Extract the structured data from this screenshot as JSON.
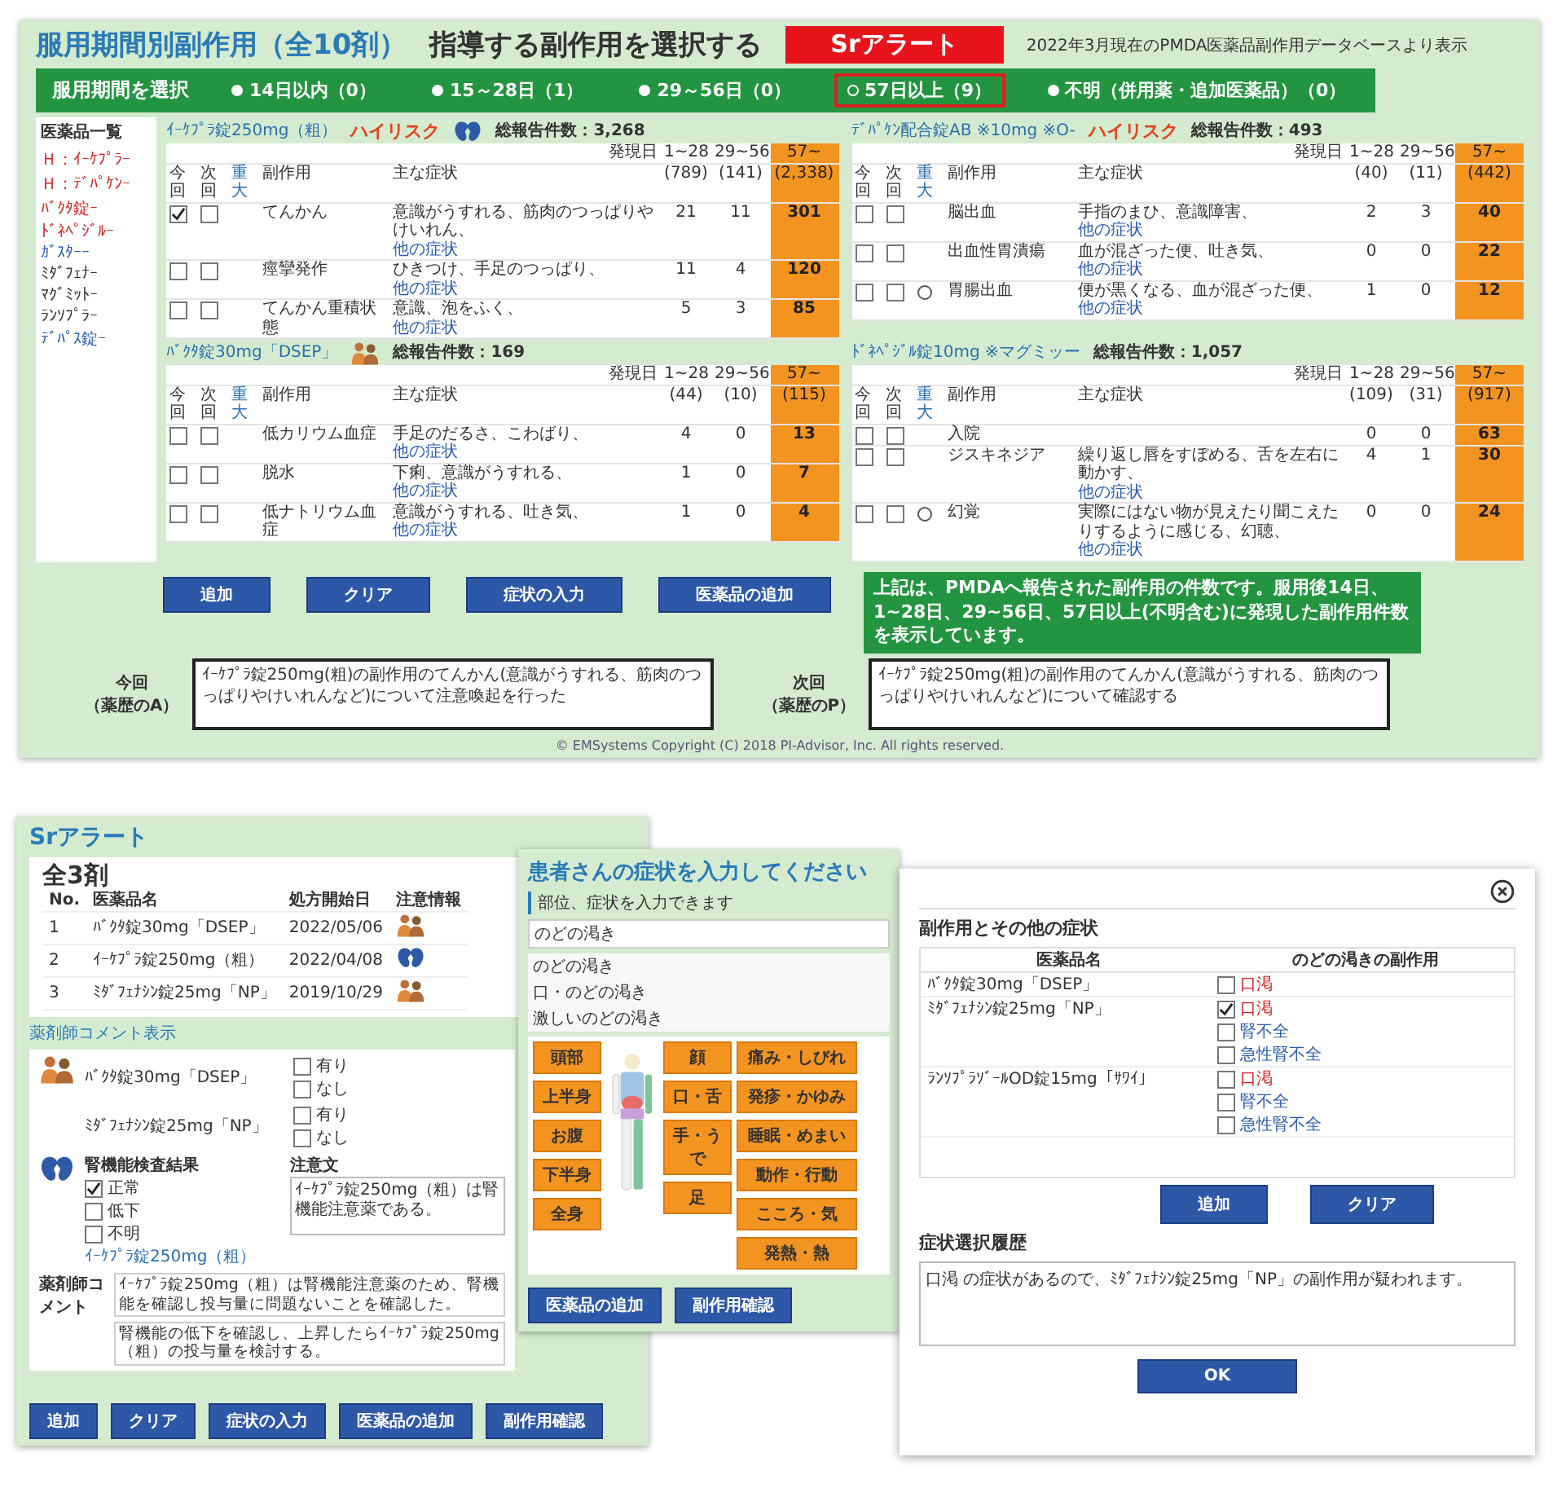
{
  "main": {
    "title": "服用期間別副作用（全10剤）",
    "subtitle": "指導する副作用を選択する",
    "alert_button": "Srアラート",
    "source_note": "2022年3月現在のPMDA医薬品副作用データベースより表示",
    "period_label": "服用期間を選択",
    "periods": [
      {
        "label": "14日以内（0）",
        "selected": false
      },
      {
        "label": "15～28日（1）",
        "selected": false
      },
      {
        "label": "29～56日（0）",
        "selected": false
      },
      {
        "label": "57日以上（9）",
        "selected": true
      },
      {
        "label": "不明（併用薬・追加医薬品）（0）",
        "selected": false
      }
    ],
    "sidebar": {
      "title": "医薬品一覧",
      "items": [
        {
          "label": "Ｈ：ｲｰｹﾌﾟﾗｰ",
          "color": "#d02828"
        },
        {
          "label": "Ｈ：ﾃﾞﾊﾟｹﾝｰ",
          "color": "#d02828"
        },
        {
          "label": "ﾊﾞｸﾀ錠ｰ",
          "color": "#d02828"
        },
        {
          "label": "ﾄﾞﾈﾍﾟｼﾞﾙｰ",
          "color": "#d02828"
        },
        {
          "label": "ｶﾞｽﾀｰｰ",
          "color": "#2a5db0"
        },
        {
          "label": "ﾐﾀﾞﾌｪﾅｰ",
          "color": "#333333"
        },
        {
          "label": "ﾏｸﾞﾐｯﾄｰ",
          "color": "#333333"
        },
        {
          "label": "ﾗﾝｿﾌﾟﾗｰ",
          "color": "#333333"
        },
        {
          "label": "ﾃﾞﾊﾟｽ錠ｰ",
          "color": "#2a5db0"
        }
      ]
    },
    "drugs": [
      {
        "name": "ｲｰｹﾌﾟﾗ錠250mg（粗）",
        "high_risk": "ハイリスク",
        "kind": "kidney",
        "total": "総報告件数：3,268",
        "onset_label": "発現日",
        "periods": [
          "1~28",
          "29~56",
          "57~"
        ],
        "counts": [
          "(789)",
          "(141)",
          "(2,338)"
        ],
        "columns": [
          "今回",
          "次回",
          "重大",
          "副作用",
          "主な症状"
        ],
        "rows": [
          {
            "now": true,
            "next": false,
            "serious": false,
            "effect": "てんかん",
            "symptom": "意識がうすれる、筋肉のつっぱりやけいれん、",
            "link": "他の症状",
            "values": [
              "21",
              "11",
              "301"
            ]
          },
          {
            "now": false,
            "next": false,
            "serious": false,
            "effect": "痙攣発作",
            "symptom": "ひきつけ、手足のつっぱり、",
            "link": "他の症状",
            "values": [
              "11",
              "4",
              "120"
            ]
          },
          {
            "now": false,
            "next": false,
            "serious": false,
            "effect": "てんかん重積状態",
            "symptom": "意識、泡をふく、",
            "link": "他の症状",
            "values": [
              "5",
              "3",
              "85"
            ]
          }
        ]
      },
      {
        "name": "ﾃﾞﾊﾟｹﾝ配合錠AB ※10mg ※O-",
        "high_risk": "ハイリスク",
        "total": "総報告件数：493",
        "onset_label": "発現日",
        "periods": [
          "1~28",
          "29~56",
          "57~"
        ],
        "counts": [
          "(40)",
          "(11)",
          "(442)"
        ],
        "columns": [
          "今回",
          "次回",
          "重大",
          "副作用",
          "主な症状"
        ],
        "rows": [
          {
            "now": false,
            "next": false,
            "serious": false,
            "effect": "脳出血",
            "symptom": "手指のまひ、意識障害、",
            "link": "他の症状",
            "values": [
              "2",
              "3",
              "40"
            ]
          },
          {
            "now": false,
            "next": false,
            "serious": false,
            "effect": "出血性胃潰瘍",
            "symptom": "血が混ざった便、吐き気、",
            "link": "他の症状",
            "values": [
              "0",
              "0",
              "22"
            ]
          },
          {
            "now": false,
            "next": false,
            "serious": true,
            "effect": "胃腸出血",
            "symptom": "便が黒くなる、血が混ざった便、",
            "link": "他の症状",
            "values": [
              "1",
              "0",
              "12"
            ]
          }
        ]
      },
      {
        "name": "ﾊﾞｸﾀ錠30mg「DSEP」",
        "kind": "people",
        "total": "総報告件数：169",
        "onset_label": "発現日",
        "periods": [
          "1~28",
          "29~56",
          "57~"
        ],
        "counts": [
          "(44)",
          "(10)",
          "(115)"
        ],
        "columns": [
          "今回",
          "次回",
          "重大",
          "副作用",
          "主な症状"
        ],
        "rows": [
          {
            "now": false,
            "next": false,
            "serious": false,
            "effect": "低カリウム血症",
            "symptom": "手足のだるさ、こわばり、",
            "link": "他の症状",
            "values": [
              "4",
              "0",
              "13"
            ]
          },
          {
            "now": false,
            "next": false,
            "serious": false,
            "effect": "脱水",
            "symptom": "下痢、意識がうすれる、",
            "link": "他の症状",
            "values": [
              "1",
              "0",
              "7"
            ]
          },
          {
            "now": false,
            "next": false,
            "serious": false,
            "effect": "低ナトリウム血症",
            "symptom": "意識がうすれる、吐き気、",
            "link": "他の症状",
            "values": [
              "1",
              "0",
              "4"
            ]
          }
        ]
      },
      {
        "name": "ﾄﾞﾈﾍﾟｼﾞﾙ錠10mg ※マグミッー",
        "total": "総報告件数：1,057",
        "onset_label": "発現日",
        "periods": [
          "1~28",
          "29~56",
          "57~"
        ],
        "counts": [
          "(109)",
          "(31)",
          "(917)"
        ],
        "columns": [
          "今回",
          "次回",
          "重大",
          "副作用",
          "主な症状"
        ],
        "rows": [
          {
            "now": false,
            "next": false,
            "serious": false,
            "effect": "入院",
            "values": [
              "0",
              "0",
              "63"
            ]
          },
          {
            "now": false,
            "next": false,
            "serious": false,
            "effect": "ジスキネジア",
            "symptom": "繰り返し唇をすぼめる、舌を左右に動かす、",
            "link": "他の症状",
            "values": [
              "4",
              "1",
              "30"
            ]
          },
          {
            "now": false,
            "next": false,
            "serious": true,
            "effect": "幻覚",
            "symptom": "実際にはない物が見えたり聞こえたりするように感じる、幻聴、",
            "link": "他の症状",
            "values": [
              "0",
              "0",
              "24"
            ]
          }
        ]
      }
    ],
    "buttons": [
      "追加",
      "クリア",
      "症状の入力",
      "医薬品の追加"
    ],
    "note": "上記は、PMDAへ報告された副作用の件数です。服用後14日、1~28日、29~56日、57日以上(不明含む)に発現した副作用件数を表示しています。",
    "memos": [
      {
        "label": "今回",
        "sublabel": "（薬歴のA）",
        "text": "ｲｰｹﾌﾟﾗ錠250mg(粗)の副作用のてんかん(意識がうすれる、筋肉のつっぱりやけいれんなど)について注意喚起を行った"
      },
      {
        "label": "次回",
        "sublabel": "（薬歴のP）",
        "text": "ｲｰｹﾌﾟﾗ錠250mg(粗)の副作用のてんかん(意識がうすれる、筋肉のつっぱりやけいれんなど)について確認する"
      }
    ],
    "footer": "© EMSystems Copyright (C) 2018 PI-Advisor, Inc. All rights reserved."
  },
  "alert_window": {
    "title": "Srアラート",
    "count": "全3剤",
    "columns": [
      "No.",
      "医薬品名",
      "処方開始日",
      "注意情報"
    ],
    "rows": [
      {
        "no": "1",
        "name": "ﾊﾞｸﾀ錠30mg「DSEP」",
        "date": "2022/05/06",
        "kind": "people"
      },
      {
        "no": "2",
        "name": "ｲｰｹﾌﾟﾗ錠250mg（粗）",
        "date": "2022/04/08",
        "kind": "kidney"
      },
      {
        "no": "3",
        "name": "ﾐﾀﾞﾌｪﾅｼﾝ錠25mg「NP」",
        "date": "2019/10/29",
        "kind": "people"
      }
    ],
    "comment_link": "薬剤師コメント表示",
    "interaction": {
      "rows": [
        {
          "name": "ﾊﾞｸﾀ錠30mg「DSEP」",
          "options": [
            {
              "label": "有り",
              "checked": false
            },
            {
              "label": "なし",
              "checked": false
            }
          ]
        },
        {
          "name": "ﾐﾀﾞﾌｪﾅｼﾝ錠25mg「NP」",
          "options": [
            {
              "label": "有り",
              "checked": false
            },
            {
              "label": "なし",
              "checked": false
            }
          ]
        }
      ]
    },
    "renal": {
      "title": "腎機能検査結果",
      "note_title": "注意文",
      "options": [
        {
          "label": "正常",
          "checked": true
        },
        {
          "label": "低下",
          "checked": false
        },
        {
          "label": "不明",
          "checked": false
        }
      ],
      "drug": "ｲｰｹﾌﾟﾗ錠250mg（粗）",
      "note": "ｲｰｹﾌﾟﾗ錠250mg（粗）は腎機能注意薬である。"
    },
    "comment_label": "薬剤師コメント",
    "comments": [
      "ｲｰｹﾌﾟﾗ錠250mg（粗）は腎機能注意薬のため、腎機能を確認し投与量に問題ないことを確認した。",
      "腎機能の低下を確認し、上昇したらｲｰｹﾌﾟﾗ錠250mg（粗）の投与量を検討する。"
    ],
    "buttons": [
      "追加",
      "クリア",
      "症状の入力",
      "医薬品の追加",
      "副作用確認"
    ]
  },
  "symptom_window": {
    "title": "患者さんの症状を入力してください",
    "input_label": "部位、症状を入力できます",
    "input_value": "のどの渇き",
    "suggestions": [
      "のどの渇き",
      "口・のどの渇き",
      "激しいのどの渇き"
    ],
    "parts_left": [
      "頭部",
      "上半身",
      "お腹",
      "下半身",
      "全身"
    ],
    "parts_right": [
      "顔",
      "口・舌",
      "手・うで",
      "足"
    ],
    "symptom_groups": [
      "痛み・しびれ",
      "発疹・かゆみ",
      "睡眠・めまい",
      "動作・行動",
      "こころ・気",
      "発熱・熱"
    ],
    "buttons": [
      "医薬品の追加",
      "副作用確認"
    ]
  },
  "dialog": {
    "title": "副作用とその他の症状",
    "columns": [
      "医薬品名",
      "のどの渇きの副作用"
    ],
    "drugs": [
      {
        "name": "ﾊﾞｸﾀ錠30mg「DSEP」",
        "effects": [
          {
            "label": "口渇",
            "checked": false,
            "color": "#d02020"
          }
        ]
      },
      {
        "name": "ﾐﾀﾞﾌｪﾅｼﾝ錠25mg「NP」",
        "effects": [
          {
            "label": "口渇",
            "checked": true,
            "color": "#d02020"
          },
          {
            "label": "腎不全",
            "checked": false,
            "color": "#2a5db0"
          },
          {
            "label": "急性腎不全",
            "checked": false,
            "color": "#2a5db0"
          }
        ]
      },
      {
        "name": "ﾗﾝｿﾌﾟﾗｿﾞｰﾙOD錠15mg「ｻﾜｲ」",
        "effects": [
          {
            "label": "口渇",
            "checked": false,
            "color": "#d02020"
          },
          {
            "label": "腎不全",
            "checked": false,
            "color": "#2a5db0"
          },
          {
            "label": "急性腎不全",
            "checked": false,
            "color": "#2a5db0"
          }
        ]
      }
    ],
    "buttons": [
      "追加",
      "クリア"
    ],
    "history_title": "症状選択履歴",
    "history": "口渇 の症状があるので、ﾐﾀﾞﾌｪﾅｼﾝ錠25mg「NP」の副作用が疑われます。",
    "ok": "OK"
  }
}
